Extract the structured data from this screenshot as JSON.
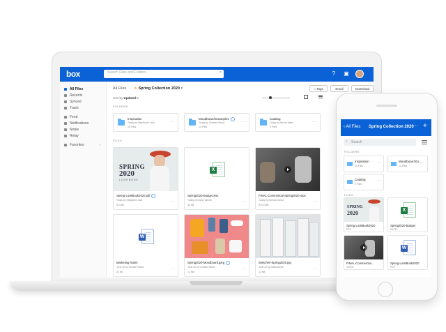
{
  "app": {
    "logo": "box",
    "search_placeholder": "Search Files and Folders"
  },
  "sidebar": {
    "items": [
      {
        "label": "All Files",
        "active": true
      },
      {
        "label": "Recents"
      },
      {
        "label": "Synced"
      },
      {
        "label": "Trash"
      },
      {
        "label": "Feed"
      },
      {
        "label": "Notifications"
      },
      {
        "label": "Notes"
      },
      {
        "label": "Relay"
      },
      {
        "label": "Favorites"
      }
    ]
  },
  "header": {
    "breadcrumb_root": "All Files",
    "breadcrumb_current": "Spring Collection 2020",
    "sort_label": "Sort by",
    "sort_value": "Updated",
    "tags_button": "Tags",
    "email_button": "Email",
    "download_button": "Download"
  },
  "folders_heading": "FOLDERS",
  "files_heading": "FILES",
  "folders": [
    {
      "name": "Inspiration",
      "owner": "Today by Stephanie Lark",
      "count": "25 Files"
    },
    {
      "name": "Moodboard Examples",
      "owner": "Today by Chester Wood",
      "count": "14 Files"
    },
    {
      "name": "Catalog",
      "owner": "Today by Nicole Miller",
      "count": "9 Files"
    }
  ],
  "files": [
    {
      "name": "Spring-LookBook2020.pdf",
      "meta": "Today by Stephanie Lark",
      "size": "5.2 MB",
      "cover_line1": "SPRING",
      "cover_line2": "2020",
      "cover_line3": "LOOKBOOK"
    },
    {
      "name": "Spring2020-Budget.xlsx",
      "meta": "Today by Diane Vander",
      "size": "48 KB"
    },
    {
      "name": "FINAL-Commerical-Spring2020.mp4",
      "meta": "Today by Monica Zenko",
      "size": "374.3 MB"
    },
    {
      "name": "Marketing Notes",
      "meta": "June 20 by Chester Wood",
      "size": "44 KB"
    },
    {
      "name": "Spring2020-Moodboard.jpeg",
      "meta": "June 20 by Chester Wood",
      "size": "12 MB"
    },
    {
      "name": "Sketches-Spring2020.jpg",
      "meta": "June 20 by David Ames",
      "size": "12 MB"
    }
  ],
  "phone": {
    "back_label": "All Files",
    "title": "Spring Collection 2020",
    "search_placeholder": "Search",
    "folders_heading": "FOLDERS",
    "files_heading": "FILES",
    "folders": [
      {
        "name": "Inspiration",
        "count": "25 Files"
      },
      {
        "name": "Moodboard Ex...",
        "count": "14 Files"
      },
      {
        "name": "Catalog",
        "count": "9 Files"
      }
    ],
    "files": [
      {
        "name": "Spring-LookBook2020",
        "type": "PDF",
        "cover_line1": "SPRING",
        "cover_line2": "2020"
      },
      {
        "name": "Spring2020-Budget",
        "type": "EXCEL"
      },
      {
        "name": "FINAL-Commercial...",
        "type": "VIDEO"
      },
      {
        "name": "Spring-LookBook2020",
        "type": "PDF"
      }
    ]
  },
  "colors": {
    "brand": "#0b62d6",
    "folder": "#64b5f6",
    "excel": "#1e7c45",
    "word": "#2b5bb5"
  }
}
